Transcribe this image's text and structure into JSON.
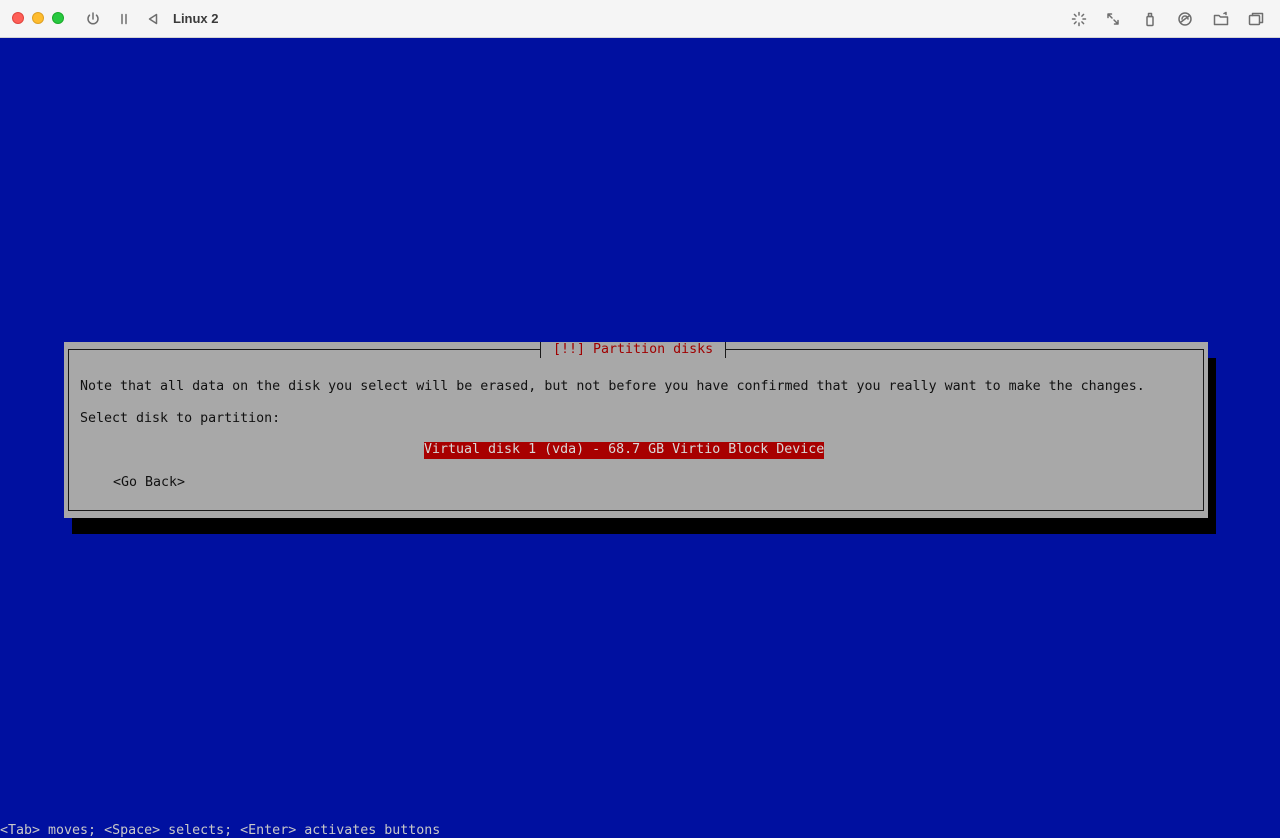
{
  "window": {
    "title": "Linux 2"
  },
  "titlebar_icons": [
    "power-icon",
    "pause-icon",
    "back-icon",
    "brightness-icon",
    "resize-icon",
    "usb-icon",
    "audio-icon",
    "shared-folder-icon",
    "display-icon"
  ],
  "installer": {
    "dialog_title": "[!!] Partition disks",
    "note": "Note that all data on the disk you select will be erased, but not before you have confirmed that you really want to make the changes.",
    "prompt": "Select disk to partition:",
    "disks": [
      {
        "label": "Virtual disk 1 (vda) - 68.7 GB Virtio Block Device",
        "selected": true
      }
    ],
    "go_back_label": "<Go Back>",
    "status_bar": "<Tab> moves; <Space> selects; <Enter> activates buttons"
  },
  "colors": {
    "background": "#0010a0",
    "dialog": "#a8a8a8",
    "title_text": "#a00000",
    "selection": "#a80000"
  }
}
